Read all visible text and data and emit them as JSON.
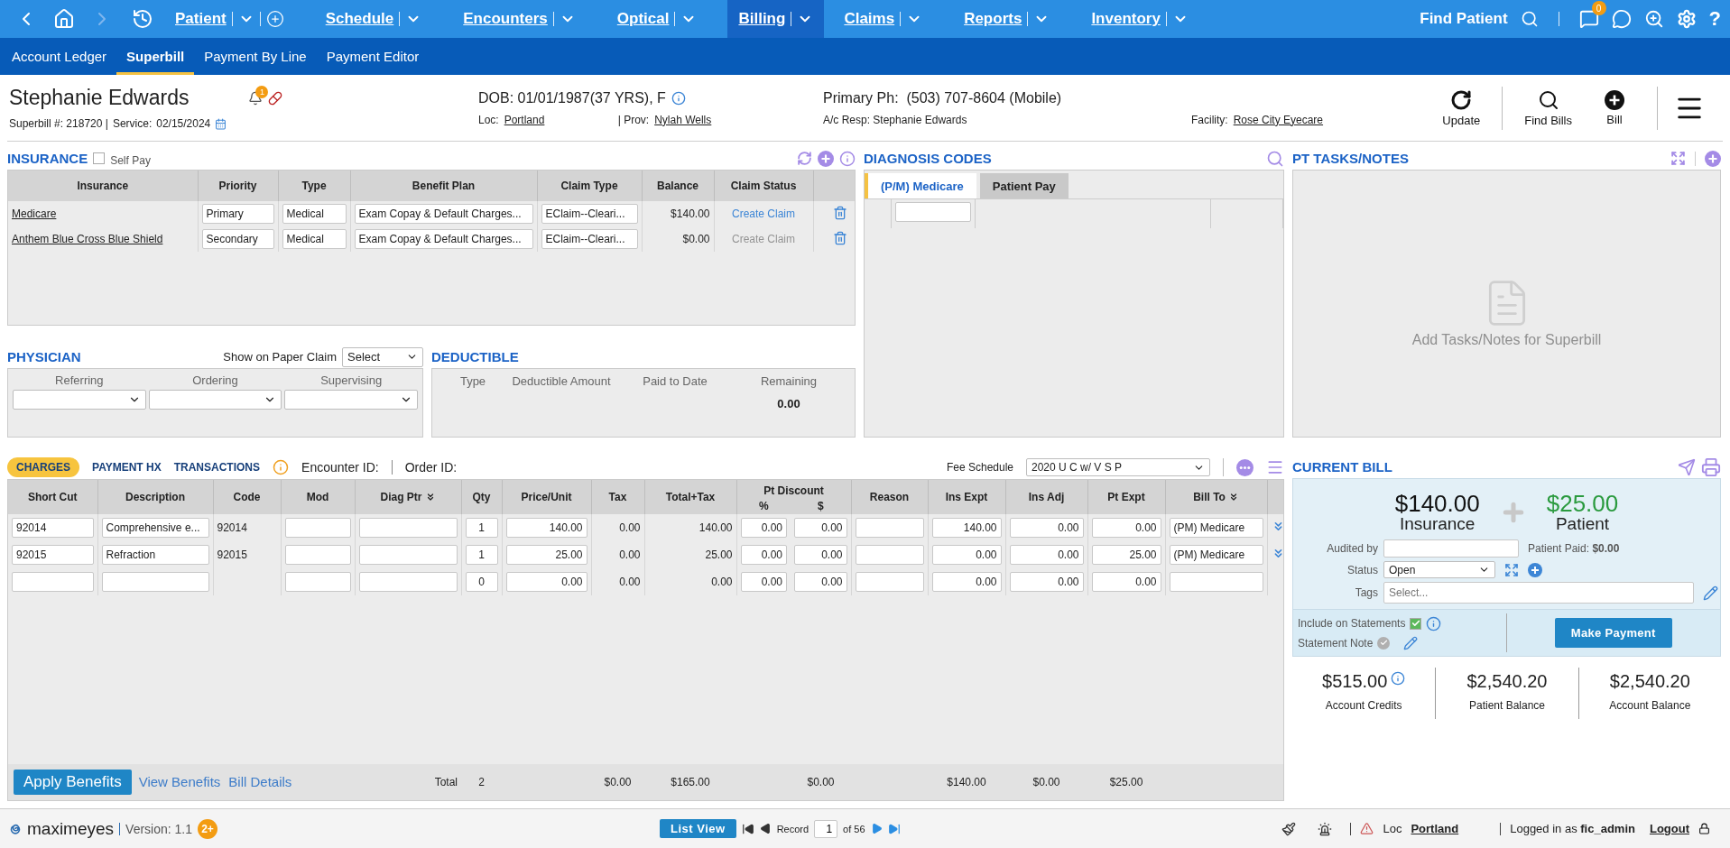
{
  "nav": {
    "items": [
      {
        "label": "Patient",
        "selected": false,
        "add": true
      },
      {
        "label": "Schedule",
        "selected": false,
        "add": false
      },
      {
        "label": "Encounters",
        "selected": false,
        "add": false
      },
      {
        "label": "Optical",
        "selected": false,
        "add": false
      },
      {
        "label": "Billing",
        "selected": true,
        "add": false
      },
      {
        "label": "Claims",
        "selected": false,
        "add": false
      },
      {
        "label": "Reports",
        "selected": false,
        "add": false
      },
      {
        "label": "Inventory",
        "selected": false,
        "add": false
      }
    ],
    "find_patient": "Find Patient",
    "sms_badge": "0",
    "help": "?"
  },
  "subnav": [
    {
      "label": "Account Ledger",
      "selected": false
    },
    {
      "label": "Superbill",
      "selected": true
    },
    {
      "label": "Payment By Line",
      "selected": false
    },
    {
      "label": "Payment Editor",
      "selected": false
    }
  ],
  "patient": {
    "name": "Stephanie Edwards",
    "alert_badge": "1",
    "superbill": "Superbill #: 218720 |",
    "service_label": "Service:",
    "service_date": "02/15/2024",
    "dob": "DOB: 01/01/1987(37 YRS), F",
    "loc_label": "Loc:",
    "loc": "Portland",
    "prov_label": "| Prov:",
    "prov": "Nylah Wells",
    "phone": "Primary Ph:  (503) 707-8604 (Mobile)",
    "resp": "A/c Resp: Stephanie Edwards",
    "facility_label": "Facility:",
    "facility": "Rose City Eyecare"
  },
  "actions": [
    {
      "label": "Update",
      "kind": "refresh"
    },
    {
      "label": "Find Bills",
      "kind": "search"
    },
    {
      "label": "Bill",
      "kind": "add"
    }
  ],
  "insurance": {
    "title": "INSURANCE",
    "self_pay": {
      "label": "Self Pay",
      "checked": false
    },
    "columns": [
      "Insurance",
      "Priority",
      "Type",
      "Benefit Plan",
      "Claim Type",
      "Balance",
      "Claim Status"
    ],
    "rows": [
      {
        "insurance": "Medicare",
        "priority": "Primary",
        "type": "Medical",
        "benefit_plan": "Exam Copay & Default Charges...",
        "claim_type": "EClaim--Cleari...",
        "balance": "$140.00",
        "claim_status": "Create Claim",
        "claim_enabled": true
      },
      {
        "insurance": "Anthem Blue Cross Blue Shield",
        "priority": "Secondary",
        "type": "Medical",
        "benefit_plan": "Exam Copay & Default Charges...",
        "claim_type": "EClaim--Cleari...",
        "balance": "$0.00",
        "claim_status": "Create Claim",
        "claim_enabled": false
      }
    ]
  },
  "physician": {
    "title": "PHYSICIAN",
    "show_label": "Show on Paper Claim",
    "show_value": "Select",
    "columns": [
      "Referring",
      "Ordering",
      "Supervising"
    ]
  },
  "deductible": {
    "title": "DEDUCTIBLE",
    "columns": [
      "Type",
      "Deductible Amount",
      "Paid to Date",
      "Remaining"
    ],
    "remaining": "0.00"
  },
  "diagnosis": {
    "title": "DIAGNOSIS CODES",
    "tabs": [
      {
        "label": "(P/M) Medicare",
        "selected": true
      },
      {
        "label": "Patient Pay",
        "selected": false
      }
    ]
  },
  "tasks": {
    "title": "PT TASKS/NOTES",
    "empty": "Add Tasks/Notes for Superbill"
  },
  "charges": {
    "tabs": [
      {
        "label": "CHARGES",
        "selected": true
      },
      {
        "label": "PAYMENT HX",
        "selected": false
      },
      {
        "label": "TRANSACTIONS",
        "selected": false
      }
    ],
    "group_label": "Pt Discount",
    "encounter_label": "Encounter ID:",
    "order_label": "Order ID:",
    "fee_label": "Fee Schedule",
    "fee_value": "2020 U C w/ V S P",
    "columns": [
      {
        "label": "Short Cut",
        "kind": "input",
        "menu": false
      },
      {
        "label": "Description",
        "kind": "input",
        "menu": false
      },
      {
        "label": "Code",
        "kind": "text",
        "menu": false
      },
      {
        "label": "Mod",
        "kind": "input",
        "menu": false
      },
      {
        "label": "Diag Ptr",
        "kind": "input",
        "menu": true
      },
      {
        "label": "Qty",
        "kind": "input",
        "menu": false
      },
      {
        "label": "Price/Unit",
        "kind": "input",
        "menu": false
      },
      {
        "label": "Tax",
        "kind": "text",
        "menu": false
      },
      {
        "label": "Total+Tax",
        "kind": "text",
        "menu": false
      },
      {
        "label": "%",
        "kind": "group-input",
        "menu": false
      },
      {
        "label": "$",
        "kind": "group-input",
        "menu": false
      },
      {
        "label": "Reason",
        "kind": "input",
        "menu": false
      },
      {
        "label": "Ins Expt",
        "kind": "input",
        "menu": false
      },
      {
        "label": "Ins Adj",
        "kind": "input",
        "menu": false
      },
      {
        "label": "Pt Expt",
        "kind": "input",
        "menu": false
      },
      {
        "label": "Bill To",
        "kind": "input",
        "menu": true
      }
    ],
    "rows": [
      {
        "cells": [
          "92014",
          "Comprehensive e...",
          "92014",
          null,
          null,
          "1",
          "140.00",
          "0.00",
          "140.00",
          "0.00",
          "0.00",
          null,
          "140.00",
          "0.00",
          "0.00",
          "(PM) Medicare"
        ],
        "expand": true
      },
      {
        "cells": [
          "92015",
          "Refraction",
          "92015",
          null,
          null,
          "1",
          "25.00",
          "0.00",
          "25.00",
          "0.00",
          "0.00",
          null,
          "0.00",
          "0.00",
          "25.00",
          "(PM) Medicare"
        ],
        "expand": true
      },
      {
        "cells": [
          null,
          null,
          null,
          null,
          null,
          "0",
          "0.00",
          "0.00",
          "0.00",
          "0.00",
          "0.00",
          null,
          "0.00",
          "0.00",
          "0.00",
          null
        ],
        "expand": false
      }
    ],
    "footer": {
      "apply": "Apply Benefits",
      "links": [
        "View Benefits",
        "Bill Details"
      ],
      "cells": [
        null,
        null,
        null,
        null,
        "Total",
        "2",
        null,
        "$0.00",
        "$165.00",
        null,
        "$0.00",
        null,
        "$140.00",
        "$0.00",
        "$25.00",
        null
      ]
    }
  },
  "current_bill": {
    "title": "CURRENT BILL",
    "insurance_amount": "$140.00",
    "insurance_label": "Insurance",
    "patient_amount": "$25.00",
    "patient_label": "Patient",
    "audited_label": "Audited by",
    "patient_paid": "Patient Paid: **$0.00**",
    "status_label": "Status",
    "status_value": "Open",
    "tags_label": "Tags",
    "tags_placeholder": "Select...",
    "include_statements": {
      "label": "Include on Statements",
      "checked": true
    },
    "statement_note": {
      "label": "Statement Note"
    },
    "make_payment": "Make Payment",
    "balances": [
      {
        "amount": "$515.00",
        "label": "Account Credits",
        "info": true
      },
      {
        "amount": "$2,540.20",
        "label": "Patient Balance",
        "info": false
      },
      {
        "amount": "$2,540.20",
        "label": "Account Balance",
        "info": false
      }
    ]
  },
  "footer": {
    "logo": "maximeyes",
    "version": "Version: 1.1",
    "badge": "2+",
    "list_view": "List View",
    "record_label": "Record",
    "record": "1",
    "record_of": "of 56",
    "loc_label": "Loc",
    "loc": "Portland",
    "logged_in": "Logged in as **fic_admin**",
    "logout": "Logout"
  }
}
